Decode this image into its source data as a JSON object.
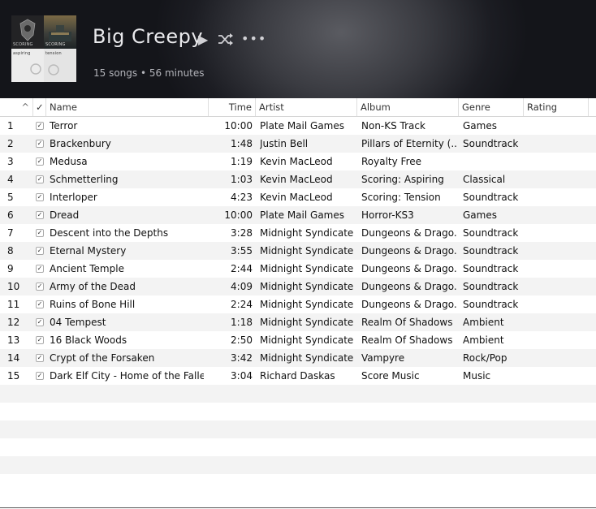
{
  "playlist": {
    "title": "Big Creepy",
    "subtitle": "15 songs • 56 minutes",
    "play_icon": "▶",
    "more_icon": "•••",
    "artwork": [
      {
        "label": "SCORING"
      },
      {
        "label": "SCORING"
      },
      {
        "label": "aspiring"
      },
      {
        "label": "tension"
      }
    ]
  },
  "columns": {
    "sort": "^",
    "check": "✓",
    "name": "Name",
    "time": "Time",
    "artist": "Artist",
    "album": "Album",
    "genre": "Genre",
    "rating": "Rating"
  },
  "tracks": [
    {
      "num": "1",
      "name": "Terror",
      "time": "10:00",
      "artist": "Plate Mail Games",
      "album": "Non-KS Track",
      "genre": "Games"
    },
    {
      "num": "2",
      "name": "Brackenbury",
      "time": "1:48",
      "artist": "Justin Bell",
      "album": "Pillars of Eternity (...",
      "genre": "Soundtrack"
    },
    {
      "num": "3",
      "name": "Medusa",
      "time": "1:19",
      "artist": "Kevin MacLeod",
      "album": "Royalty Free",
      "genre": ""
    },
    {
      "num": "4",
      "name": "Schmetterling",
      "time": "1:03",
      "artist": "Kevin MacLeod",
      "album": "Scoring: Aspiring",
      "genre": "Classical"
    },
    {
      "num": "5",
      "name": "Interloper",
      "time": "4:23",
      "artist": "Kevin MacLeod",
      "album": "Scoring: Tension",
      "genre": "Soundtrack"
    },
    {
      "num": "6",
      "name": "Dread",
      "time": "10:00",
      "artist": "Plate Mail Games",
      "album": "Horror-KS3",
      "genre": "Games"
    },
    {
      "num": "7",
      "name": "Descent into the Depths",
      "time": "3:28",
      "artist": "Midnight Syndicate",
      "album": "Dungeons & Drago...",
      "genre": "Soundtrack"
    },
    {
      "num": "8",
      "name": "Eternal Mystery",
      "time": "3:55",
      "artist": "Midnight Syndicate",
      "album": "Dungeons & Drago...",
      "genre": "Soundtrack"
    },
    {
      "num": "9",
      "name": "Ancient Temple",
      "time": "2:44",
      "artist": "Midnight Syndicate",
      "album": "Dungeons & Drago...",
      "genre": "Soundtrack"
    },
    {
      "num": "10",
      "name": "Army of the Dead",
      "time": "4:09",
      "artist": "Midnight Syndicate",
      "album": "Dungeons & Drago...",
      "genre": "Soundtrack"
    },
    {
      "num": "11",
      "name": "Ruins of Bone Hill",
      "time": "2:24",
      "artist": "Midnight Syndicate",
      "album": "Dungeons & Drago...",
      "genre": "Soundtrack"
    },
    {
      "num": "12",
      "name": "04 Tempest",
      "time": "1:18",
      "artist": "Midnight Syndicate",
      "album": "Realm Of Shadows",
      "genre": "Ambient"
    },
    {
      "num": "13",
      "name": "16 Black Woods",
      "time": "2:50",
      "artist": "Midnight Syndicate",
      "album": "Realm Of Shadows",
      "genre": "Ambient"
    },
    {
      "num": "14",
      "name": "Crypt of the Forsaken",
      "time": "3:42",
      "artist": "Midnight Syndicate",
      "album": "Vampyre",
      "genre": "Rock/Pop"
    },
    {
      "num": "15",
      "name": "Dark Elf City - Home of the Falle...",
      "time": "3:04",
      "artist": "Richard Daskas",
      "album": "Score Music",
      "genre": "Music"
    }
  ]
}
